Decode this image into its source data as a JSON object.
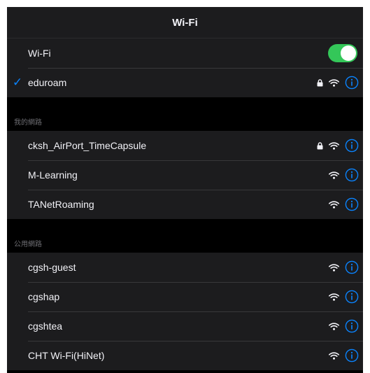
{
  "header": {
    "title": "Wi-Fi"
  },
  "wifi_toggle": {
    "label": "Wi-Fi",
    "on": true,
    "color": "#34c759"
  },
  "connected": {
    "name": "eduroam",
    "secured": true,
    "check": "✓"
  },
  "sections": {
    "my_networks": {
      "header": "我的網路"
    },
    "public_networks": {
      "header": "公用網路"
    }
  },
  "my_networks": [
    {
      "name": "cksh_AirPort_TimeCapsule",
      "secured": true
    },
    {
      "name": "M-Learning",
      "secured": false
    },
    {
      "name": "TANetRoaming",
      "secured": false
    }
  ],
  "public_networks": [
    {
      "name": "cgsh-guest",
      "secured": false
    },
    {
      "name": "cgshap",
      "secured": false
    },
    {
      "name": "cgshtea",
      "secured": false
    },
    {
      "name": "CHT Wi-Fi(HiNet)",
      "secured": false
    }
  ],
  "colors": {
    "accent": "#0a84ff",
    "background": "#000000",
    "cell": "#1c1c1e"
  },
  "icons": {
    "lock": "lock-icon",
    "wifi": "wifi-icon",
    "info": "info-icon",
    "check": "checkmark-icon"
  }
}
